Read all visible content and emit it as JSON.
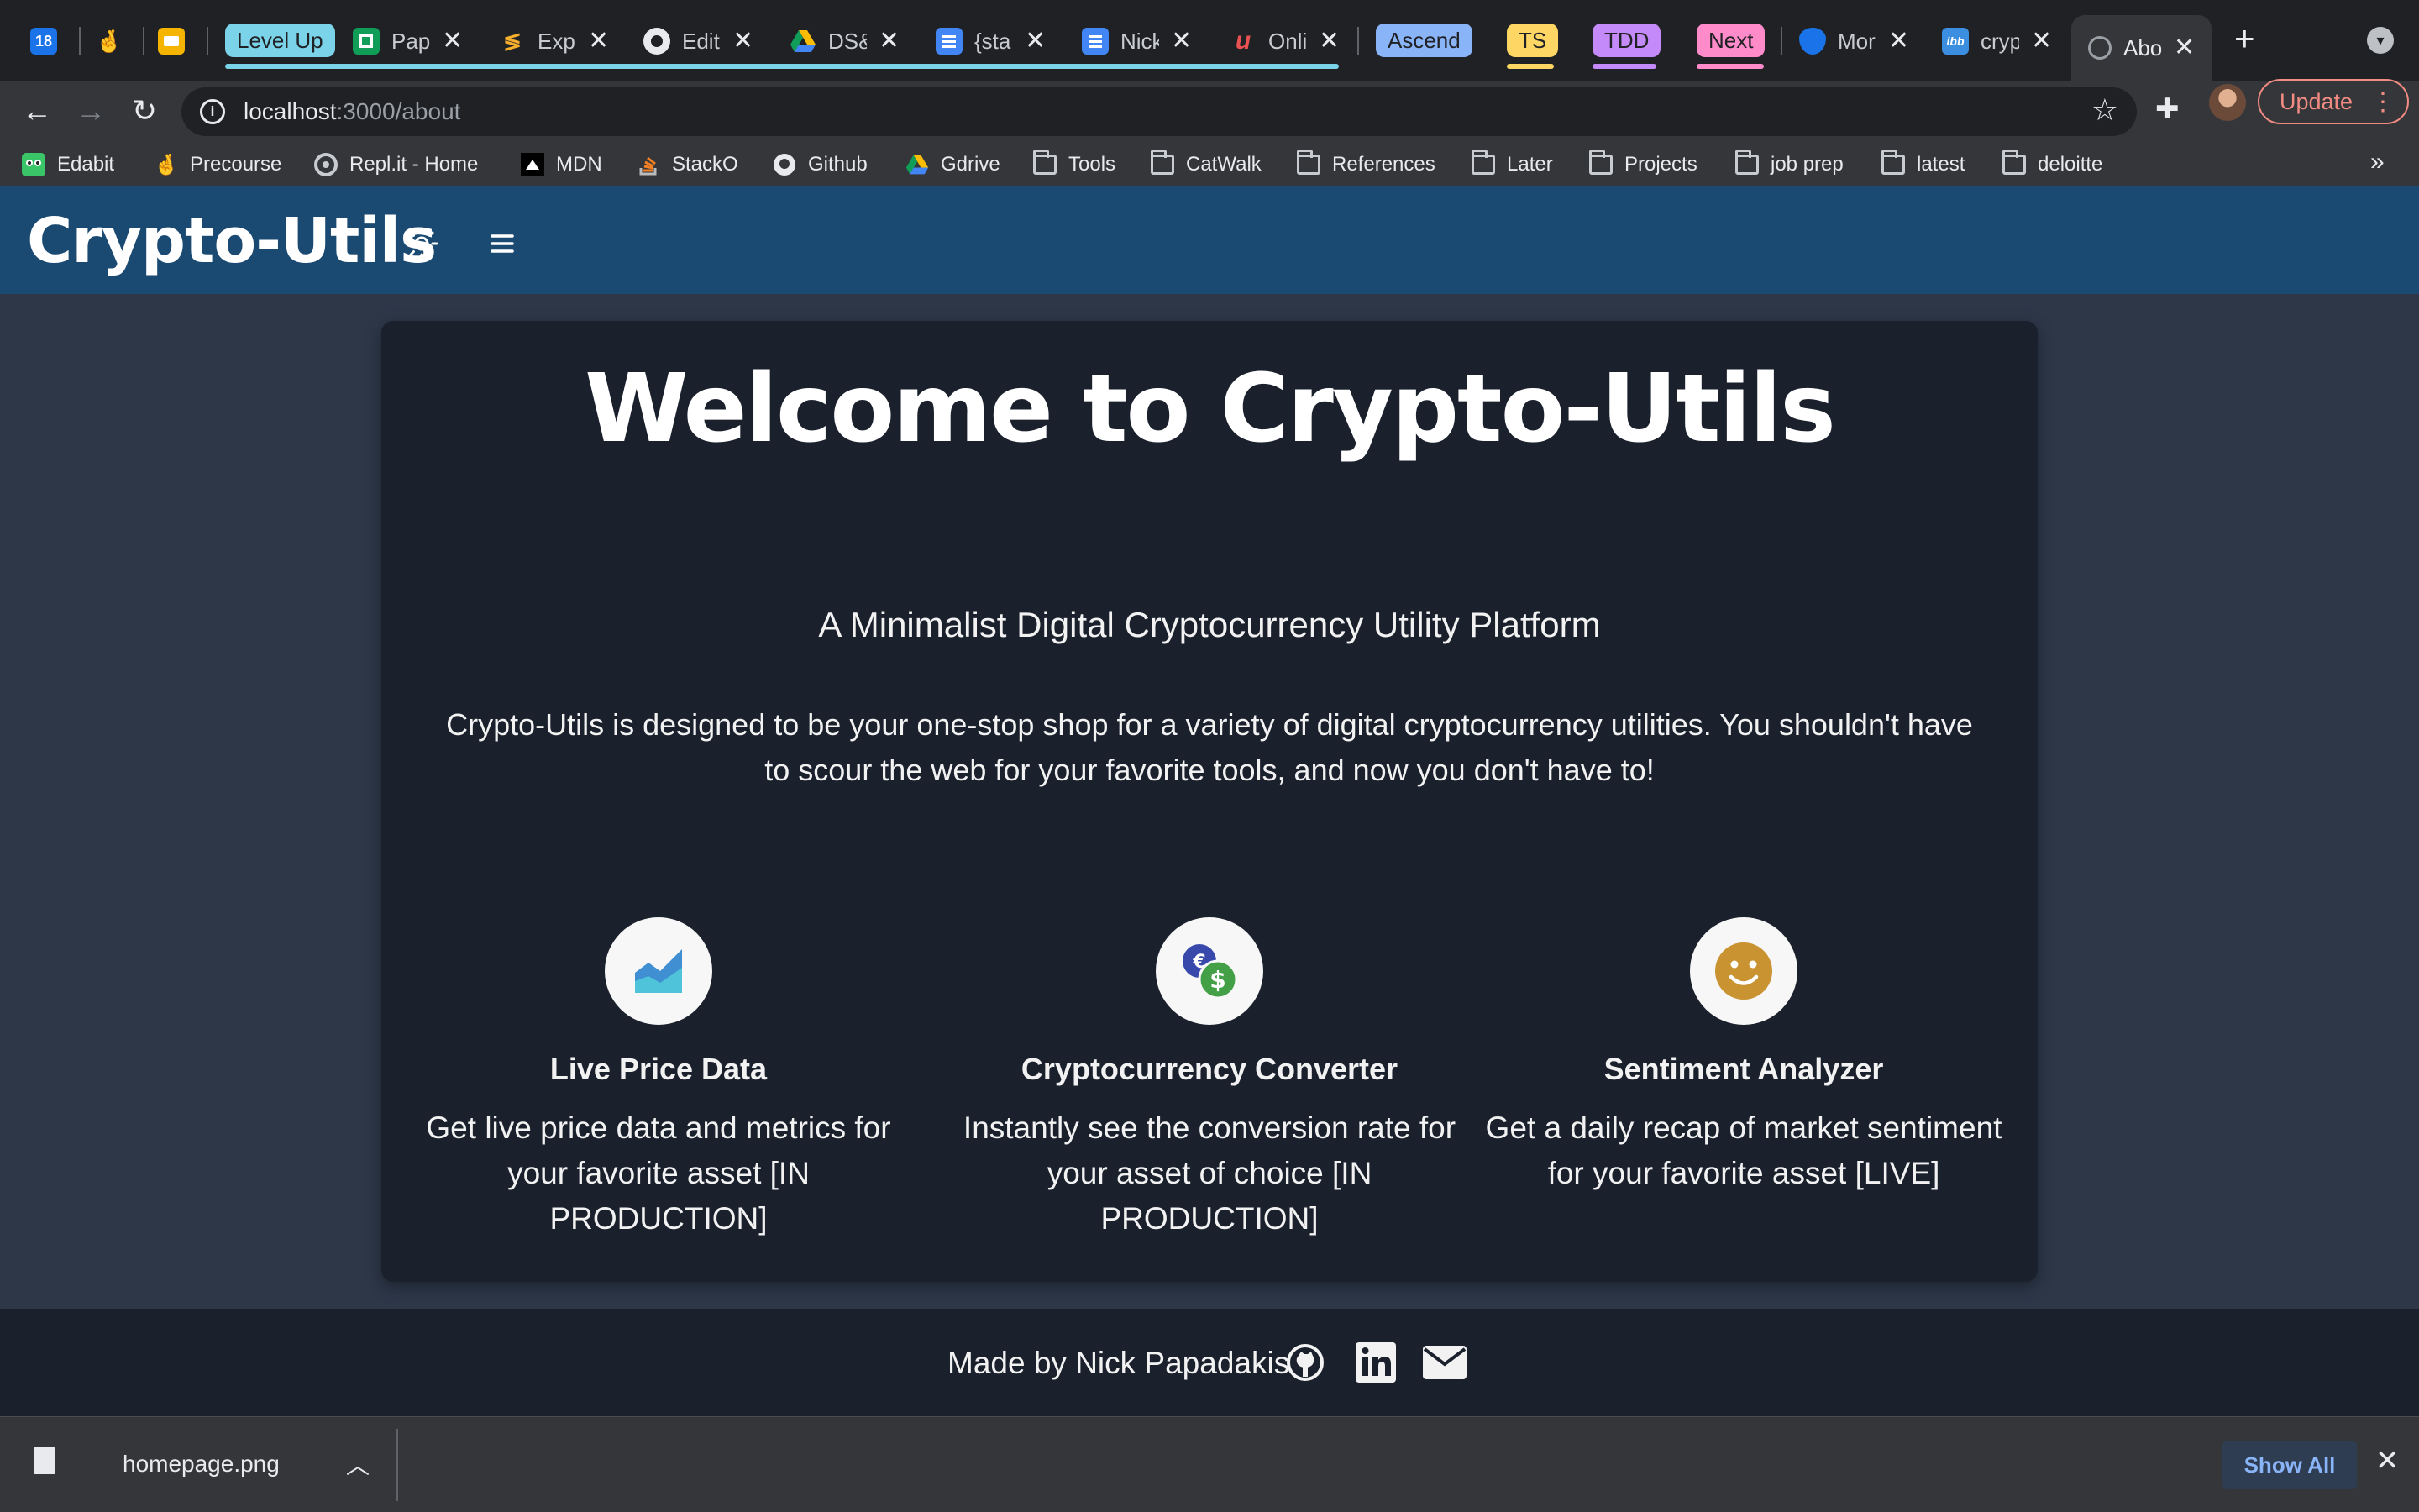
{
  "browser": {
    "tabs": [
      {
        "favicon": "calendar-icon",
        "label": "18"
      },
      {
        "favicon": "precourse-hand-icon",
        "label": "🤞"
      },
      {
        "favicon": "slides-icon",
        "label": ""
      },
      {
        "group": "Level Up",
        "color": "#7ad3e8"
      },
      {
        "favicon": "sheets-icon",
        "title": "Pap"
      },
      {
        "favicon": "codewars-icon",
        "title": "Expl"
      },
      {
        "favicon": "github-icon",
        "title": "Edit"
      },
      {
        "favicon": "gdrive-icon",
        "title": "DS&"
      },
      {
        "favicon": "docs-icon",
        "title": "{sta"
      },
      {
        "favicon": "docs-icon",
        "title": "Nick"
      },
      {
        "favicon": "udemy-icon",
        "title": "Onli"
      },
      {
        "group": "Ascend",
        "color": "#8ab4f8"
      },
      {
        "group": "TS",
        "color": "#fdd663"
      },
      {
        "group": "TDD",
        "color": "#c58af9"
      },
      {
        "group": "Next",
        "color": "#ff8bcb"
      },
      {
        "favicon": "shield-icon",
        "title": "Mor"
      },
      {
        "favicon": "ibb-icon",
        "title": "cryp"
      },
      {
        "favicon": "globe-icon",
        "title": "Abo",
        "active": true
      }
    ],
    "url_host": "localhost",
    "url_path": ":3000/about",
    "update_label": "Update",
    "bookmarks": [
      {
        "icon": "edabit-icon",
        "label": "Edabit"
      },
      {
        "icon": "precourse-icon",
        "label": "Precourse"
      },
      {
        "icon": "replit-icon",
        "label": "Repl.it - Home"
      },
      {
        "icon": "mdn-icon",
        "label": "MDN"
      },
      {
        "icon": "stackoverflow-icon",
        "label": "StackO"
      },
      {
        "icon": "github-icon",
        "label": "Github"
      },
      {
        "icon": "gdrive-icon",
        "label": "Gdrive"
      },
      {
        "icon": "folder-icon",
        "label": "Tools"
      },
      {
        "icon": "folder-icon",
        "label": "CatWalk"
      },
      {
        "icon": "folder-icon",
        "label": "References"
      },
      {
        "icon": "folder-icon",
        "label": "Later"
      },
      {
        "icon": "folder-icon",
        "label": "Projects"
      },
      {
        "icon": "folder-icon",
        "label": "job prep"
      },
      {
        "icon": "folder-icon",
        "label": "latest"
      },
      {
        "icon": "folder-icon",
        "label": "deloitte"
      }
    ],
    "bookmarks_overflow": "»"
  },
  "app": {
    "brand": "Crypto-Utils",
    "colors": {
      "header": "#1a4971",
      "background": "#2d3748",
      "card": "#1a202c"
    },
    "hero_title": "Welcome to Crypto-Utils",
    "hero_subtitle": "A Minimalist Digital Cryptocurrency Utility Platform",
    "intro": "Crypto-Utils is designed to be your one-stop shop for a variety of digital cryptocurrency utilities. You shouldn't have to scour the web for your favorite tools, and now you don't have to!",
    "features": [
      {
        "icon": "area-chart-icon",
        "title": "Live Price Data",
        "description": "Get live price data and metrics for your favorite asset [IN PRODUCTION]"
      },
      {
        "icon": "currency-exchange-icon",
        "title": "Cryptocurrency Converter",
        "description": "Instantly see the conversion rate for your asset of choice [IN PRODUCTION]"
      },
      {
        "icon": "smiley-icon",
        "title": "Sentiment Analyzer",
        "description": "Get a daily recap of market sentiment for your favorite asset [LIVE]"
      }
    ],
    "footer_text": "Made by Nick Papadakis"
  },
  "downloads": {
    "file_name": "homepage.png",
    "show_all": "Show All"
  }
}
